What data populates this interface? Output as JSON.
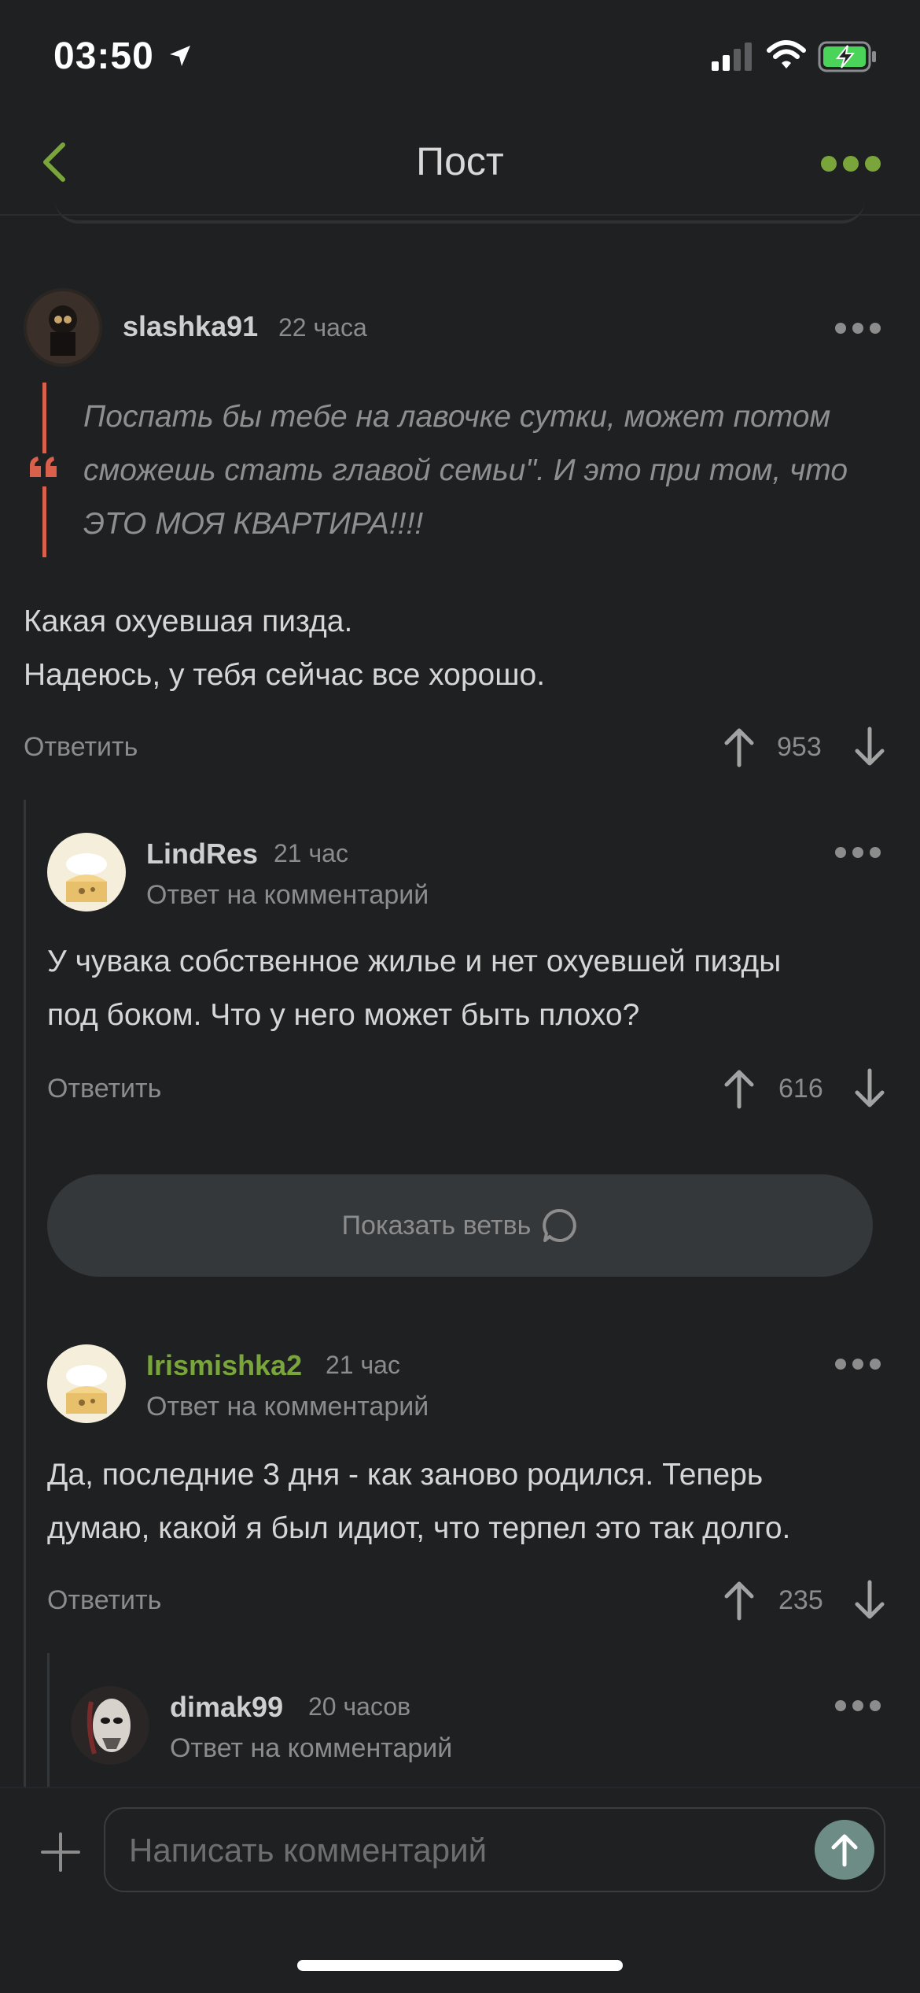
{
  "status_bar": {
    "time": "03:50"
  },
  "header": {
    "title": "Пост"
  },
  "colors": {
    "accent_green": "#79a53a",
    "quote_bar": "#d9614c",
    "background": "#1e2022"
  },
  "comments": [
    {
      "username": "slashka91",
      "time": "22 часа",
      "quote_lines": [
        "Поспать бы тебе на лавочке сутки, может потом",
        "сможешь стать главой семьи\". И это при том, что",
        "ЭТО МОЯ КВАРТИРА!!!!"
      ],
      "text_lines": [
        "Какая охуевшая пизда.",
        "Надеюсь, у тебя сейчас все хорошо."
      ],
      "reply_label": "Ответить",
      "score": "953"
    },
    {
      "username": "LindRes",
      "time": "21 час",
      "reply_to": "Ответ на комментарий",
      "text_lines": [
        "У чувака собственное жилье и нет охуевшей пизды",
        "под боком. Что у него может быть плохо?"
      ],
      "reply_label": "Ответить",
      "score": "616"
    },
    {
      "username": "Irismishka2",
      "time": "21 час",
      "reply_to": "Ответ на комментарий",
      "text_lines": [
        "Да, последние 3 дня - как заново родился. Теперь",
        "думаю, какой я был идиот, что терпел это так долго."
      ],
      "reply_label": "Ответить",
      "score": "235"
    },
    {
      "username": "dimak99",
      "time": "20 часов",
      "reply_to": "Ответ на комментарий"
    }
  ],
  "show_branch": {
    "label": "Показать ветвь"
  },
  "composer": {
    "placeholder": "Написать комментарий"
  }
}
